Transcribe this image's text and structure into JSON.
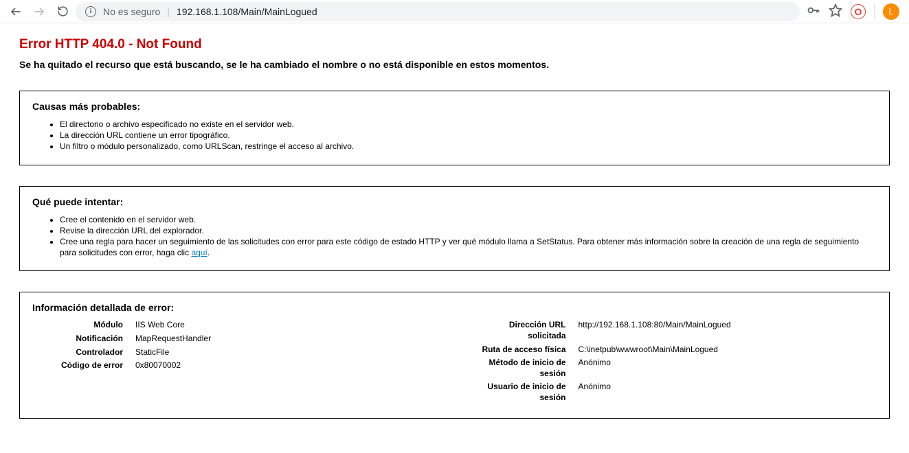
{
  "chrome": {
    "security_label": "No es seguro",
    "url": "192.168.1.108/Main/MainLogued",
    "avatar_initial": "L",
    "opera_letter": "O"
  },
  "page": {
    "error_title": "Error HTTP 404.0 - Not Found",
    "error_subtitle": "Se ha quitado el recurso que está buscando, se le ha cambiado el nombre o no está disponible en estos momentos."
  },
  "causes": {
    "title": "Causas más probables:",
    "items": [
      "El directorio o archivo especificado no existe en el servidor web.",
      "La dirección URL contiene un error tipográfico.",
      "Un filtro o módulo personalizado, como URLScan, restringe el acceso al archivo."
    ]
  },
  "try": {
    "title": "Qué puede intentar:",
    "items": [
      "Cree el contenido en el servidor web.",
      "Revise la dirección URL del explorador."
    ],
    "rule_text_before": "Cree una regla para hacer un seguimiento de las solicitudes con error para este código de estado HTTP y ver qué módulo llama a SetStatus. Para obtener más información sobre la creación de una regla de seguimiento para solicitudes con error, haga clic ",
    "rule_link": "aquí",
    "rule_text_after": "."
  },
  "details": {
    "title": "Información detallada de error:",
    "left": {
      "modulo_label": "Módulo",
      "modulo_value": "IIS Web Core",
      "notificacion_label": "Notificación",
      "notificacion_value": "MapRequestHandler",
      "controlador_label": "Controlador",
      "controlador_value": "StaticFile",
      "codigo_label": "Código de error",
      "codigo_value": "0x80070002"
    },
    "right": {
      "url_label": "Dirección URL solicitada",
      "url_value": "http://192.168.1.108:80/Main/MainLogued",
      "ruta_label": "Ruta de acceso física",
      "ruta_value": "C:\\inetpub\\wwwroot\\Main\\MainLogued",
      "metodo_label": "Método de inicio de sesión",
      "metodo_value": "Anónimo",
      "usuario_label": "Usuario de inicio de sesión",
      "usuario_value": "Anónimo"
    }
  }
}
